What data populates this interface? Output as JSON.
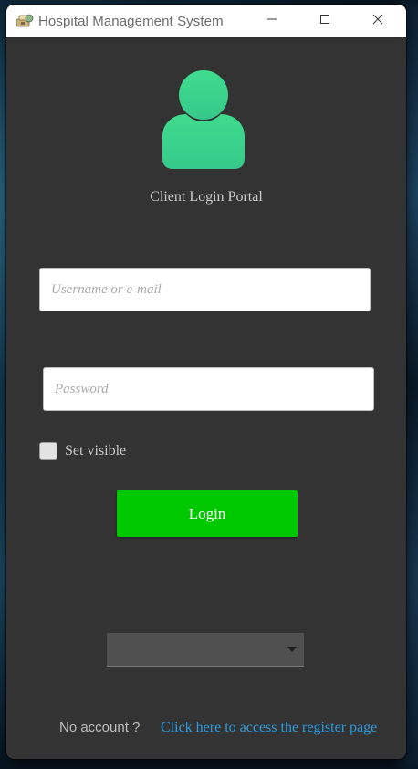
{
  "window": {
    "title": "Hospital Management System"
  },
  "login": {
    "portal_title": "Client Login Portal",
    "username_placeholder": "Username or e-mail",
    "password_placeholder": "Password",
    "show_password_label": "Set visible",
    "show_password_checked": false,
    "login_button_label": "Login"
  },
  "dropdown": {
    "selected": ""
  },
  "footer": {
    "no_account_text": "No account ?",
    "register_link_text": "Click here to access the register page"
  },
  "colors": {
    "window_bg": "#333333",
    "avatar": "#3ddb8a",
    "login_button": "#00c800",
    "link": "#2e9bdc"
  },
  "icons": {
    "app": "hospital-app-icon",
    "minimize": "minimize-icon",
    "maximize": "maximize-icon",
    "close": "close-icon",
    "avatar": "user-avatar-icon",
    "dropdown": "chevron-down-icon"
  }
}
